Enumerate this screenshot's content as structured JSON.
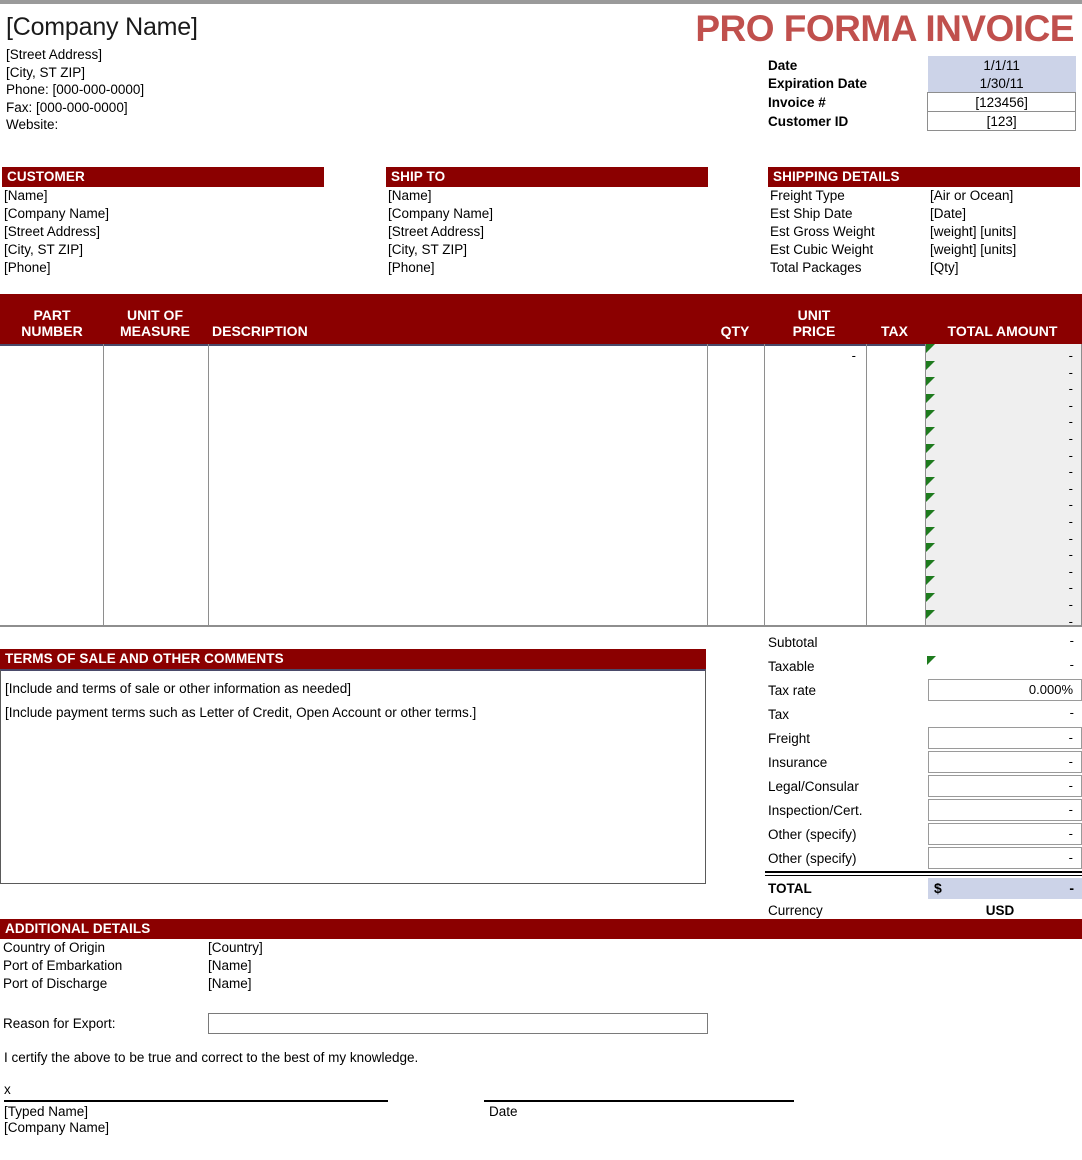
{
  "header": {
    "company_name": "[Company Name]",
    "street": "[Street Address]",
    "city": "[City, ST  ZIP]",
    "phone": "Phone:  [000-000-0000]",
    "fax": "Fax: [000-000-0000]",
    "website": "Website:",
    "title": "PRO FORMA INVOICE",
    "meta": [
      {
        "label": "Date",
        "value": "1/1/11",
        "style": "blue"
      },
      {
        "label": "Expiration Date",
        "value": "1/30/11",
        "style": "blue"
      },
      {
        "label": "Invoice #",
        "value": "[123456]",
        "style": "box"
      },
      {
        "label": "Customer ID",
        "value": "[123]",
        "style": "box"
      }
    ]
  },
  "customer": {
    "heading": "CUSTOMER",
    "lines": [
      "[Name]",
      "[Company Name]",
      "[Street Address]",
      "[City, ST  ZIP]",
      "[Phone]"
    ]
  },
  "ship_to": {
    "heading": "SHIP TO",
    "lines": [
      "[Name]",
      "[Company Name]",
      "[Street Address]",
      "[City, ST  ZIP]",
      "[Phone]"
    ]
  },
  "shipping_details": {
    "heading": "SHIPPING DETAILS",
    "rows": [
      {
        "key": "Freight Type",
        "value": "[Air or Ocean]"
      },
      {
        "key": "Est Ship Date",
        "value": "[Date]"
      },
      {
        "key": "Est Gross Weight",
        "value": "[weight] [units]"
      },
      {
        "key": "Est Cubic Weight",
        "value": "[weight] [units]"
      },
      {
        "key": "Total Packages",
        "value": "[Qty]"
      }
    ]
  },
  "items_table": {
    "columns": [
      {
        "name": "part-number",
        "line1": "PART",
        "line2": "NUMBER"
      },
      {
        "name": "unit-of-measure",
        "line1": "UNIT OF",
        "line2": "MEASURE"
      },
      {
        "name": "description",
        "line1": "",
        "line2": "DESCRIPTION"
      },
      {
        "name": "qty",
        "line1": "",
        "line2": "QTY"
      },
      {
        "name": "unit-price",
        "line1": "UNIT",
        "line2": "PRICE"
      },
      {
        "name": "tax",
        "line1": "",
        "line2": "TAX"
      },
      {
        "name": "total-amount",
        "line1": "",
        "line2": "TOTAL AMOUNT"
      }
    ],
    "row_count": 17,
    "empty_value": "-"
  },
  "terms": {
    "heading": "TERMS OF SALE AND OTHER COMMENTS",
    "lines": [
      "[Include and terms of sale or other information as needed]",
      "[Include payment terms such as Letter of Credit, Open Account or other terms.]"
    ]
  },
  "totals": {
    "rows": [
      {
        "label": "Subtotal",
        "value": "-",
        "boxed": false,
        "flag": false
      },
      {
        "label": "Taxable",
        "value": "-",
        "boxed": false,
        "flag": true
      },
      {
        "label": "Tax rate",
        "value": "0.000%",
        "boxed": true,
        "flag": false
      },
      {
        "label": "Tax",
        "value": "-",
        "boxed": false,
        "flag": false
      },
      {
        "label": "Freight",
        "value": "-",
        "boxed": true,
        "flag": false
      },
      {
        "label": "Insurance",
        "value": "-",
        "boxed": true,
        "flag": false
      },
      {
        "label": "Legal/Consular",
        "value": "-",
        "boxed": true,
        "flag": false
      },
      {
        "label": "Inspection/Cert.",
        "value": "-",
        "boxed": true,
        "flag": false
      },
      {
        "label": "Other (specify)",
        "value": "-",
        "boxed": true,
        "flag": false
      },
      {
        "label": "Other (specify)",
        "value": "-",
        "boxed": true,
        "flag": false
      }
    ],
    "total_label": "TOTAL",
    "total_currency_symbol": "$",
    "total_value": "-",
    "currency_label": "Currency",
    "currency_value": "USD"
  },
  "additional_details": {
    "heading": "ADDITIONAL DETAILS",
    "rows": [
      {
        "key": "Country of Origin",
        "value": "[Country]"
      },
      {
        "key": "Port of Embarkation",
        "value": "[Name]"
      },
      {
        "key": "Port of Discharge",
        "value": "[Name]"
      }
    ],
    "reason_label": "Reason for Export:",
    "reason_value": ""
  },
  "signature": {
    "certify": "I certify the above to be true and correct to the best of my knowledge.",
    "x_mark": "x",
    "typed_name": "[Typed Name]",
    "company_name": "[Company Name]",
    "date_label": "Date"
  },
  "colors": {
    "band_red": "#8b0000",
    "title_red": "#c0504d",
    "highlight_blue": "#ccd3e8",
    "shade_gray": "#efefef",
    "flag_green": "#1e7b1e"
  }
}
